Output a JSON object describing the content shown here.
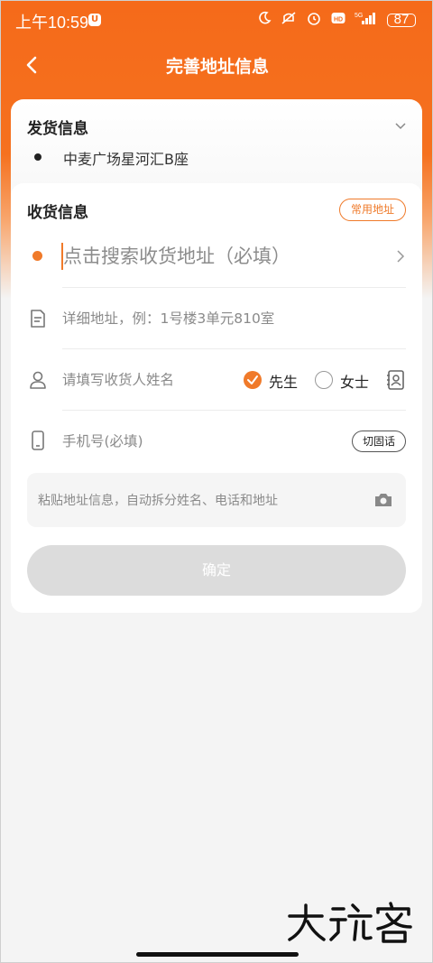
{
  "status_bar": {
    "time": "上午10:59",
    "u_badge": "U",
    "network": "5G",
    "battery": "87",
    "icons": [
      "moon-icon",
      "mute-icon",
      "alarm-icon",
      "hd-icon",
      "signal-icon",
      "battery-icon"
    ]
  },
  "nav": {
    "title": "完善地址信息",
    "back_icon": "chevron-left-icon"
  },
  "sender": {
    "title": "发货信息",
    "address": "中麦广场星河汇B座"
  },
  "receiver": {
    "title": "收货信息",
    "common_address_label": "常用地址",
    "search_placeholder": "点击搜索收货地址（必填）",
    "detail_placeholder": "详细地址，例：1号楼3单元810室",
    "name_placeholder": "请填写收货人姓名",
    "gender_options": [
      {
        "label": "先生",
        "selected": true
      },
      {
        "label": "女士",
        "selected": false
      }
    ],
    "phone_placeholder": "手机号(必填)",
    "switch_tel_label": "切固话",
    "paste_placeholder": "粘贴地址信息，自动拆分姓名、电话和地址",
    "confirm_label": "确定"
  },
  "colors": {
    "accent": "#f07a2a",
    "header": "#f56a1a",
    "disabled_button": "#dcdcdc"
  },
  "watermark": "大玩客"
}
